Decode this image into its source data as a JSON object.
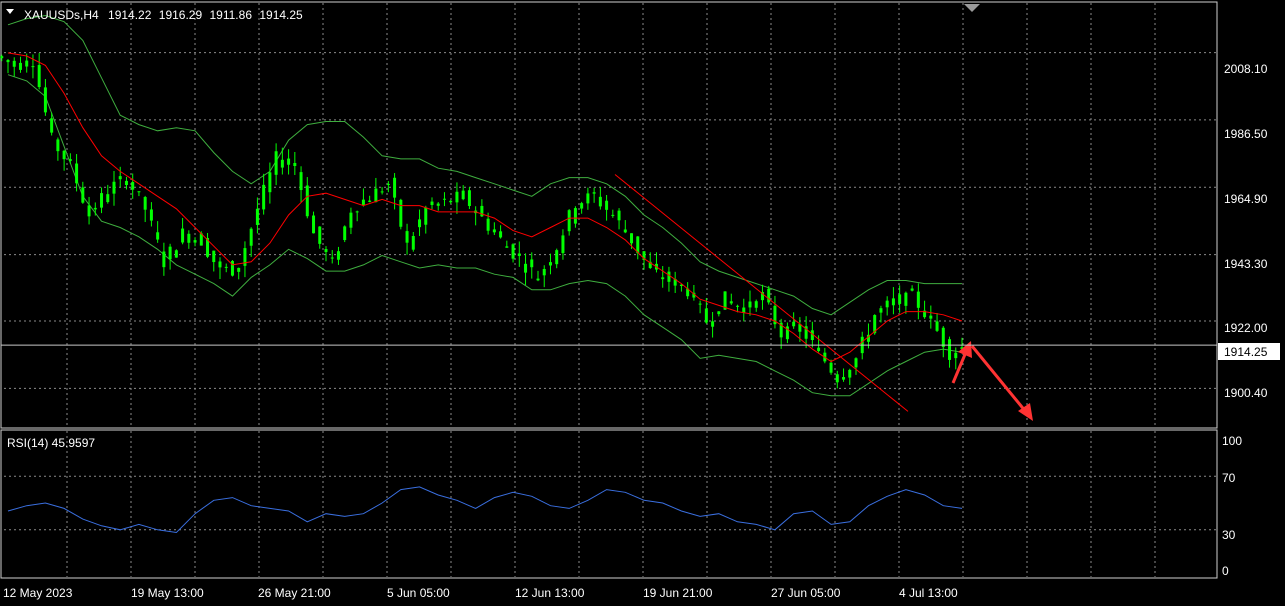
{
  "symbol_header": {
    "symbol": "XAUUSDs,H4",
    "open": "1914.22",
    "high": "1916.29",
    "low": "1911.86",
    "close": "1914.25"
  },
  "colors": {
    "background": "#000000",
    "grid": "#8a8a8a",
    "bull_candle": "#00ff00",
    "bands": "#3fae3f",
    "moving_average": "#ff0000",
    "rsi_line": "#3a6fe0",
    "price_tag_bg": "#ffffff",
    "arrows": "#ff3333"
  },
  "chart_data": [
    {
      "type": "line",
      "title": "XAUUSDs,H4",
      "x": [
        "12 May 2023",
        "19 May 13:00",
        "26 May 21:00",
        "5 Jun 05:00",
        "12 Jun 13:00",
        "19 Jun 21:00",
        "27 Jun 05:00",
        "4 Jul 13:00"
      ],
      "series": [
        {
          "type": "candlestick",
          "close": [
            2004,
            2006,
            1980,
            1972,
            1956,
            1964,
            1968,
            1958,
            1941,
            1950,
            1948,
            1938,
            1940,
            1958,
            1974,
            1972,
            1950,
            1940,
            1958,
            1962,
            1966,
            1946,
            1958,
            1960,
            1962,
            1955,
            1948,
            1942,
            1936,
            1946,
            1960,
            1962,
            1956,
            1948,
            1938,
            1935,
            1932,
            1922,
            1929,
            1926,
            1930,
            1918,
            1920,
            1912,
            1904,
            1910,
            1924,
            1928,
            1930,
            1922,
            1912,
            1914.25
          ]
        },
        {
          "name": "",
          "type": "moving-average",
          "values": [
            2008,
            2007,
            2004,
            1995,
            1984,
            1975,
            1970,
            1966,
            1962,
            1958,
            1952,
            1946,
            1940,
            1941,
            1947,
            1956,
            1962,
            1963,
            1961,
            1959,
            1961,
            1959,
            1959,
            1957,
            1957,
            1957,
            1955,
            1951,
            1949,
            1952,
            1955,
            1955,
            1952,
            1948,
            1942,
            1938,
            1934,
            1929,
            1927,
            1925,
            1924,
            1922,
            1918,
            1913,
            1909,
            1912,
            1917,
            1922,
            1925,
            1925,
            1924,
            1922
          ]
        },
        {
          "name": "",
          "type": "band-upper",
          "values": [
            2017,
            2019,
            2020,
            2018,
            2012,
            2000,
            1988,
            1985,
            1983,
            1984,
            1983,
            1976,
            1970,
            1966,
            1970,
            1980,
            1985,
            1986,
            1986,
            1981,
            1975,
            1974,
            1974,
            1971,
            1970,
            1968,
            1966,
            1964,
            1962,
            1966,
            1968,
            1968,
            1966,
            1962,
            1956,
            1952,
            1947,
            1941,
            1938,
            1936,
            1934,
            1932,
            1930,
            1926,
            1924,
            1928,
            1932,
            1935,
            1935,
            1934,
            1934,
            1934
          ]
        },
        {
          "name": "",
          "type": "band-lower",
          "values": [
            2001,
            1999,
            1994,
            1978,
            1962,
            1954,
            1952,
            1949,
            1945,
            1940,
            1937,
            1934,
            1930,
            1936,
            1940,
            1945,
            1942,
            1938,
            1938,
            1940,
            1943,
            1941,
            1939,
            1940,
            1939,
            1939,
            1937,
            1936,
            1932,
            1932,
            1934,
            1935,
            1934,
            1930,
            1924,
            1920,
            1916,
            1910,
            1911,
            1910,
            1909,
            1906,
            1903,
            1899,
            1898,
            1898,
            1902,
            1906,
            1909,
            1912,
            1913,
            1912
          ]
        },
        {
          "name": "",
          "type": "trend-line",
          "values": [
            1969,
            1893
          ]
        }
      ],
      "ylabel": "",
      "y_ticks": [
        2008.1,
        1986.5,
        1964.9,
        1943.3,
        1922.0,
        1900.4
      ],
      "ylim": [
        1888,
        2024
      ],
      "current_price": 1914.25,
      "grid": true
    },
    {
      "type": "line",
      "title": "RSI(14) 45.9597",
      "series": [
        {
          "name": "",
          "values": [
            44,
            48,
            50,
            46,
            38,
            33,
            30,
            34,
            30,
            28,
            42,
            52,
            54,
            48,
            46,
            44,
            36,
            42,
            40,
            42,
            50,
            60,
            62,
            56,
            52,
            46,
            54,
            58,
            55,
            48,
            46,
            52,
            60,
            58,
            52,
            50,
            44,
            40,
            42,
            36,
            34,
            30,
            42,
            44,
            34,
            36,
            48,
            55,
            60,
            56,
            48,
            45.96
          ]
        }
      ],
      "y_ticks": [
        100,
        70,
        30,
        0
      ],
      "ylim": [
        0,
        100
      ],
      "grid": true
    }
  ],
  "x_axis_labels": [
    "12 May 2023",
    "19 May 13:00",
    "26 May 21:00",
    "5 Jun 05:00",
    "12 Jun 13:00",
    "19 Jun 21:00",
    "27 Jun 05:00",
    "4 Jul 13:00"
  ],
  "price_axis_labels": [
    "2008.10",
    "1986.50",
    "1964.90",
    "1943.30",
    "1922.00",
    "1900.40"
  ],
  "current_price_tag": "1914.25",
  "rsi_header": "RSI(14) 45.9597",
  "rsi_axis_labels": [
    "100",
    "70",
    "30",
    "0"
  ]
}
